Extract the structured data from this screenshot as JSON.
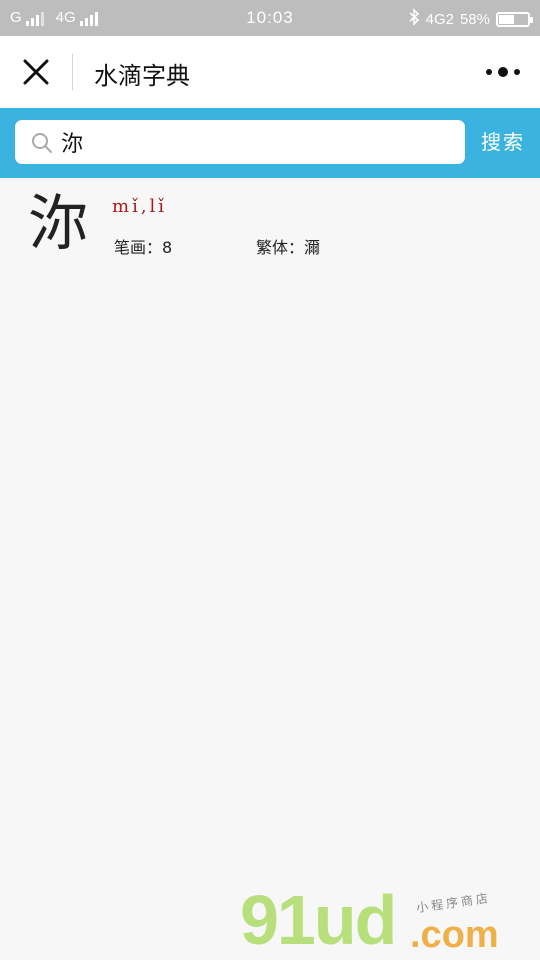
{
  "status_bar": {
    "carrier1": "G",
    "carrier2": "4G",
    "time": "10:03",
    "network": "4G2",
    "battery": "58%",
    "battery_level": 0.58,
    "icons": [
      "signal-icon",
      "bluetooth-icon",
      "battery-icon"
    ]
  },
  "titlebar": {
    "title": "水滴字典",
    "close_icon": "close-icon",
    "more_icon": "more-icon"
  },
  "search": {
    "value": "沵",
    "placeholder": "",
    "button_label": "搜索",
    "icon": "search-icon",
    "accent": "#3ab3e0"
  },
  "result": {
    "character": "沵",
    "pinyin": "mǐ,lǐ",
    "strokes_label": "笔画：",
    "strokes_value": "8",
    "traditional_label": "繁体：",
    "traditional_value": "濔",
    "pinyin_color": "#a51c1c"
  },
  "watermark": {
    "main": "91ud",
    "domain": ".com",
    "sub": "小程序商店"
  }
}
